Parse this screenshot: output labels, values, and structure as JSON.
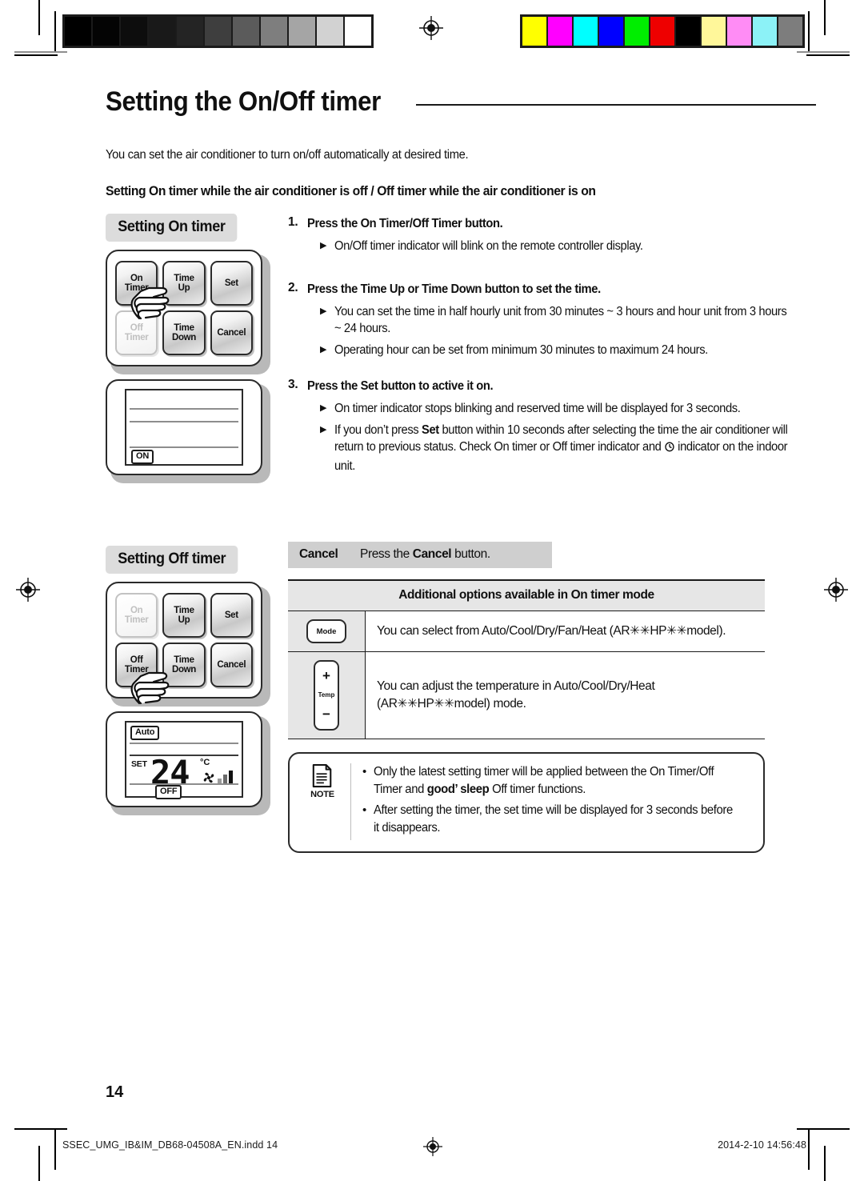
{
  "header": {
    "title": "Setting the On/Off timer",
    "intro": "You can set the air conditioner to turn on/off automatically at desired time.",
    "subheading": "Setting On timer while the air conditioner is off / Off timer while the air conditioner is on"
  },
  "on_timer_section": {
    "chip_label": "Setting On timer",
    "keypad": {
      "keys": [
        {
          "line1": "On",
          "line2": "Timer",
          "state": "active"
        },
        {
          "line1": "Time",
          "line2": "Up",
          "state": "normal"
        },
        {
          "line1": "Set",
          "line2": "",
          "state": "normal"
        },
        {
          "line1": "Off",
          "line2": "Timer",
          "state": "dim"
        },
        {
          "line1": "Time",
          "line2": "Down",
          "state": "normal"
        },
        {
          "line1": "Cancel",
          "line2": "",
          "state": "normal"
        }
      ],
      "hand_on_key": "On Timer"
    },
    "lcd": {
      "indicator": "ON"
    }
  },
  "off_timer_section": {
    "chip_label": "Setting Off timer",
    "keypad": {
      "keys": [
        {
          "line1": "On",
          "line2": "Timer",
          "state": "dim"
        },
        {
          "line1": "Time",
          "line2": "Up",
          "state": "normal"
        },
        {
          "line1": "Set",
          "line2": "",
          "state": "normal"
        },
        {
          "line1": "Off",
          "line2": "Timer",
          "state": "active"
        },
        {
          "line1": "Time",
          "line2": "Down",
          "state": "normal"
        },
        {
          "line1": "Cancel",
          "line2": "",
          "state": "normal"
        }
      ],
      "hand_on_key": "Off Timer"
    },
    "lcd": {
      "mode_badge": "Auto",
      "set_label": "SET",
      "temperature": "24",
      "unit": "°C",
      "indicator": "OFF",
      "fan_bars": 3
    }
  },
  "steps": [
    {
      "number": "1.",
      "heading_parts": [
        {
          "text": "Press the ",
          "bold": false
        },
        {
          "text": "On Timer/Off Timer",
          "bold": true
        },
        {
          "text": " button.",
          "bold": false
        }
      ],
      "bullets": [
        [
          {
            "text": "On/Off timer indicator will blink on the remote controller display.",
            "bold": false
          }
        ]
      ]
    },
    {
      "number": "2.",
      "heading_parts": [
        {
          "text": "Press the ",
          "bold": false
        },
        {
          "text": "Time Up",
          "bold": true
        },
        {
          "text": " or ",
          "bold": false
        },
        {
          "text": "Time Down",
          "bold": true
        },
        {
          "text": " button to set the time.",
          "bold": false
        }
      ],
      "bullets": [
        [
          {
            "text": "You can set the time in half hourly unit from 30 minutes ~ 3 hours and hour unit from 3 hours ~ 24 hours.",
            "bold": false
          }
        ],
        [
          {
            "text": "Operating hour can be set from minimum 30 minutes to maximum 24 hours.",
            "bold": false
          }
        ]
      ]
    },
    {
      "number": "3.",
      "heading_parts": [
        {
          "text": "Press the ",
          "bold": false
        },
        {
          "text": "Set",
          "bold": true
        },
        {
          "text": " button to active it on.",
          "bold": false
        }
      ],
      "bullets": [
        [
          {
            "text": "On timer indicator stops blinking and reserved time will be displayed for 3 seconds.",
            "bold": false
          }
        ],
        [
          {
            "text": "If you don’t press ",
            "bold": false
          },
          {
            "text": "Set",
            "bold": true
          },
          {
            "text": " button within 10 seconds after selecting the time the air conditioner will return to previous status. Check On timer or Off timer indicator and ",
            "bold": false
          },
          {
            "text": "⏱",
            "icon": "clock-icon"
          },
          {
            "text": " indicator on the indoor unit.",
            "bold": false
          }
        ]
      ]
    }
  ],
  "cancel_strip": {
    "label": "Cancel",
    "text_parts": [
      {
        "text": "Press the ",
        "bold": false
      },
      {
        "text": "Cancel",
        "bold": true
      },
      {
        "text": " button.",
        "bold": false
      }
    ]
  },
  "options_table": {
    "header": "Additional options available in On timer mode",
    "rows": [
      {
        "icon_name": "mode-button-icon",
        "icon_label": "Mode",
        "text": "You can select from Auto/Cool/Dry/Fan/Heat (AR✳✳HP✳✳model)."
      },
      {
        "icon_name": "temp-button-icon",
        "icon_label": "Temp",
        "icon_plus": "+",
        "icon_minus": "−",
        "text": "You can adjust the temperature in Auto/Cool/Dry/Heat (AR✳✳HP✳✳model) mode."
      }
    ]
  },
  "note_box": {
    "label": "NOTE",
    "bullets": [
      [
        {
          "text": "Only the latest setting timer will be applied between the On Timer/Off Timer and ",
          "bold": false
        },
        {
          "text": "good’ sleep",
          "bold": true
        },
        {
          "text": " Off timer functions.",
          "bold": false
        }
      ],
      [
        {
          "text": "After setting the timer, the set time will be displayed for 3 seconds before it disappears.",
          "bold": false
        }
      ]
    ]
  },
  "page_number": "14",
  "footer": {
    "file": "SSEC_UMG_IB&IM_DB68-04508A_EN.indd   14",
    "timestamp": "2014-2-10   14:56:48"
  },
  "calibration": {
    "grayscale": [
      "#000000",
      "#040404",
      "#0d0d0d",
      "#191919",
      "#242424",
      "#3e3e3e",
      "#5b5b5b",
      "#7e7e7e",
      "#a5a5a5",
      "#d2d2d2",
      "#ffffff"
    ],
    "colors": [
      "#ffff00",
      "#ff00ff",
      "#00ffff",
      "#0000ff",
      "#00ee00",
      "#ee0000",
      "#000000",
      "#fff79a",
      "#ff8cf5",
      "#8cf2f7",
      "#7d7d7d"
    ]
  }
}
